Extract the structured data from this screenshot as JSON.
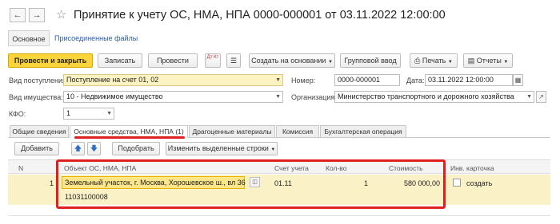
{
  "window": {
    "title": "Принятие к учету ОС, НМА, НПА 0000-000001 от 03.11.2022 12:00:00",
    "back_icon": "arrow-left-icon",
    "forward_icon": "arrow-right-icon",
    "favorite_icon": "star-icon"
  },
  "main_tabs": [
    "Основное",
    "Присоединенные файлы"
  ],
  "toolbar": {
    "post_close": "Провести и закрыть",
    "save": "Записать",
    "post": "Провести",
    "dt_kt": "Дт Кт",
    "create_based": "Создать на основании",
    "group_input": "Групповой ввод",
    "print": "Печать",
    "reports": "Отчеты"
  },
  "form": {
    "receipt_type_label": "Вид поступления:",
    "receipt_type_value": "Поступление на счет 01, 02",
    "number_label": "Номер:",
    "number_value": "0000-000001",
    "date_label": "Дата:",
    "date_value": "03.11.2022 12:00:00",
    "property_type_label": "Вид имущества:",
    "property_type_value": "10 - Недвижимое имущество",
    "org_label": "Организация:",
    "org_value": "Министерство транспортного и дорожного хозяйства",
    "kfo_label": "КФО:",
    "kfo_value": "1"
  },
  "page_tabs": [
    "Общие сведения",
    "Основные средства, НМА, НПА (1)",
    "Драгоценные материалы",
    "Комиссия",
    "Бухгалтерская операция"
  ],
  "table_toolbar": {
    "add": "Добавить",
    "pick": "Подобрать",
    "change_rows": "Изменить выделенные строки"
  },
  "table": {
    "columns": [
      "N",
      "Объект ОС, НМА, НПА",
      "Счет учета",
      "Кол-во",
      "Стоимость",
      "Инв. карточка"
    ],
    "rows": [
      {
        "n": "1",
        "object": "Земельный участок, г. Москва, Хорошевское ш., вл 36",
        "object_code": "11031100008",
        "account": "01.11",
        "qty": "1",
        "cost": "580 000,00",
        "card": "создать"
      }
    ]
  },
  "colors": {
    "accent_yellow": "#fbd33a",
    "highlight_field": "#fdf2c2",
    "annotation_red": "#e02020"
  }
}
